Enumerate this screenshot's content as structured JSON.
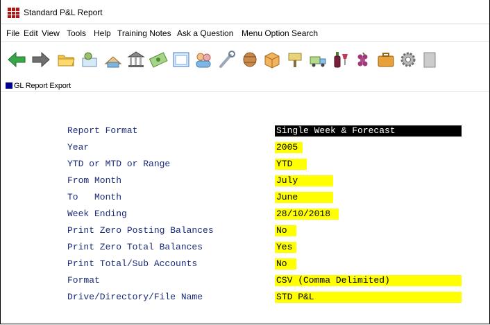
{
  "window": {
    "title": "Standard P&L Report"
  },
  "menu": [
    "File",
    "Edit",
    "View",
    "Tools",
    "Help",
    "Training Notes",
    "Ask a Question",
    "Menu Option Search"
  ],
  "toolbar": {
    "icons": [
      "back-arrow-icon",
      "forward-arrow-icon",
      "folder-icon",
      "customer-icon",
      "supplier-icon",
      "bank-icon",
      "money-icon",
      "calendar-icon",
      "people-icon",
      "tool-icon",
      "barrel-icon",
      "box-icon",
      "sign-icon",
      "delivery-icon",
      "wine-icon",
      "grapes-icon",
      "briefcase-icon",
      "gear-icon",
      "document-icon"
    ]
  },
  "subwindow": {
    "title": "GL Report Export"
  },
  "form": {
    "report_format": {
      "label": "Report Format",
      "value": "Single Week & Forecast"
    },
    "year": {
      "label": "Year",
      "value": "2005"
    },
    "ytd_mtd_range": {
      "label": "YTD or MTD or Range",
      "value": "YTD"
    },
    "from_month": {
      "label": "From Month",
      "value": "July"
    },
    "to_month": {
      "label": "To   Month",
      "value": "June"
    },
    "week_ending": {
      "label": "Week Ending",
      "value": "28/10/2018"
    },
    "print_zero_posting": {
      "label": "Print Zero Posting Balances",
      "value": "No"
    },
    "print_zero_total": {
      "label": "Print Zero Total Balances",
      "value": "Yes"
    },
    "print_total_sub": {
      "label": "Print Total/Sub Accounts",
      "value": "No"
    },
    "format": {
      "label": "Format",
      "value": "CSV (Comma Delimited)"
    },
    "file_name": {
      "label": "Drive/Directory/File Name",
      "value": "STD P&L"
    }
  },
  "colors": {
    "field_bg": "#ffff00",
    "label_text": "#1a2a7a",
    "selected_bg": "#000000"
  }
}
